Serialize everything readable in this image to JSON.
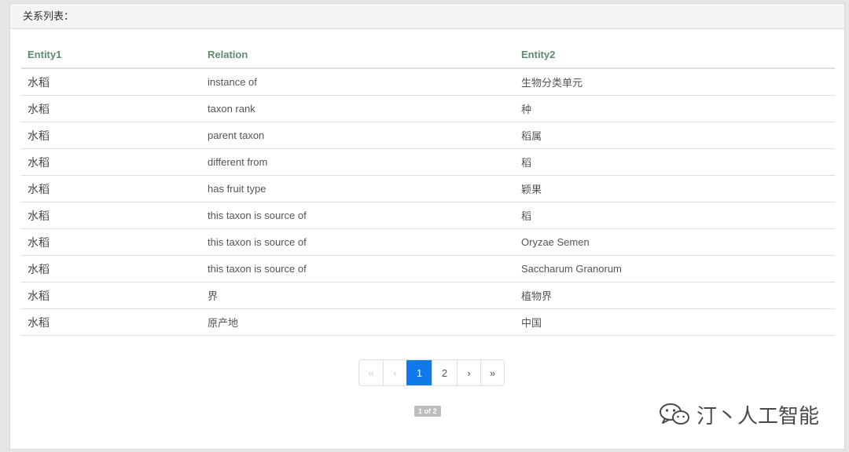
{
  "panel": {
    "title": "关系列表："
  },
  "table": {
    "headers": [
      "Entity1",
      "Relation",
      "Entity2"
    ],
    "rows": [
      [
        "水稻",
        "instance of",
        "生物分类单元"
      ],
      [
        "水稻",
        "taxon rank",
        "种"
      ],
      [
        "水稻",
        "parent taxon",
        "稻属"
      ],
      [
        "水稻",
        "different from",
        "稻"
      ],
      [
        "水稻",
        "has fruit type",
        "颖果"
      ],
      [
        "水稻",
        "this taxon is source of",
        "稻"
      ],
      [
        "水稻",
        "this taxon is source of",
        "Oryzae Semen"
      ],
      [
        "水稻",
        "this taxon is source of",
        "Saccharum Granorum"
      ],
      [
        "水稻",
        "界",
        "植物界"
      ],
      [
        "水稻",
        "原产地",
        "中国"
      ]
    ]
  },
  "pagination": {
    "first": "«",
    "prev": "‹",
    "pages": [
      "1",
      "2"
    ],
    "current": "1",
    "next": "›",
    "last": "»",
    "info": "1 of 2"
  },
  "watermark": {
    "text": "汀丶人工智能",
    "icon": "wechat-icon"
  },
  "colors": {
    "header_text": "#5e8a6e",
    "active_page": "#1279e8",
    "info_badge": "#bdbdbd"
  }
}
